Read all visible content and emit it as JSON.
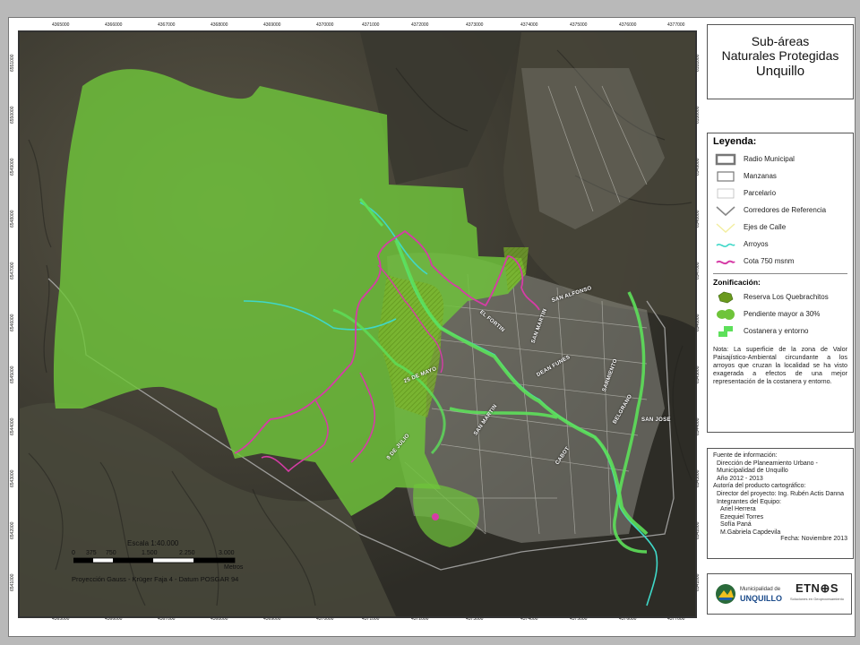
{
  "title": {
    "line1": "Sub-áreas",
    "line2": "Naturales Protegidas",
    "line3": "Unquillo"
  },
  "legend": {
    "heading": "Leyenda:",
    "items": [
      {
        "label": "Radio Municipal",
        "icon": "radio-municipal-symbol"
      },
      {
        "label": "Manzanas",
        "icon": "manzanas-symbol"
      },
      {
        "label": "Parcelario",
        "icon": "parcelario-symbol"
      },
      {
        "label": "Corredores de Referencia",
        "icon": "corredores-symbol"
      },
      {
        "label": "Ejes de Calle",
        "icon": "ejes-calle-symbol"
      },
      {
        "label": "Arroyos",
        "icon": "arroyos-symbol"
      },
      {
        "label": "Cota 750 msnm",
        "icon": "cota-symbol"
      }
    ],
    "zoning_heading": "Zonificación:",
    "zoning": [
      {
        "label": "Reserva Los Quebrachitos",
        "color": "#6a9a1e"
      },
      {
        "label": "Pendiente mayor a 30%",
        "color": "#6fc43a"
      },
      {
        "label": "Costanera y entorno",
        "color": "#5de05a"
      }
    ],
    "note": "Nota: La superficie de la zona de Valor Paisajístico-Ambiental circundante a los arroyos que cruzan la localidad se ha visto exagerada a efectos de una mejor representación de la costanera y entorno."
  },
  "source": {
    "l1": "Fuente de información:",
    "l2": "Dirección de Planeamiento Urbano -",
    "l3": "Municipalidad de Unquillo",
    "l4": "Año 2012 - 2013",
    "l5": "Autoría del producto cartográfico:",
    "l6": "Director del proyecto: Ing. Rubén Actis Danna",
    "l7": "Integrantes del Equipo:",
    "l8": "Ariel Herrera",
    "l9": "Ezequiel Torres",
    "l10": "Sofía Paná",
    "l11": "M.Gabriela Capdevila",
    "date": "Fecha: Noviembre 2013"
  },
  "logos": {
    "municipality_top": "Municipalidad de",
    "municipality_name": "UNQUILLO",
    "company_pre": "ETN",
    "company_post": "S",
    "company_tagline": "Soluciones en Geoprocesamiento"
  },
  "grid": {
    "x_labels": [
      "4365000",
      "4366000",
      "4367000",
      "4368000",
      "4369000",
      "4370000",
      "4371000",
      "4372000",
      "4373000",
      "4374000",
      "4375000",
      "4376000",
      "4377000"
    ],
    "y_labels": [
      "6551000",
      "6550000",
      "6549000",
      "6548000",
      "6547000",
      "6546000",
      "6545000",
      "6544000",
      "6543000",
      "6542000",
      "6541000"
    ]
  },
  "scale": {
    "title": "Escala 1:40.000",
    "ticks": [
      "0",
      "375",
      "750",
      "1.500",
      "2.250",
      "3.000"
    ],
    "unit": "Metros",
    "projection": "Proyección Gauss - Krüger Faja 4 - Datum POSGAR 94"
  },
  "streets": [
    "SAN ALFONSO",
    "SARMIENTO",
    "SAN MARTIN",
    "DEAN FUNES",
    "BELGRANO",
    "SAN JOSE",
    "25 DE MAYO",
    "9 DE JULIO",
    "EL FORTIN",
    "SAN MARTIN",
    "CABOT"
  ],
  "colors": {
    "reserve": "#6a9a1e",
    "slope": "#6fc43a",
    "costanera": "#5de05a",
    "cota": "#d63ca6",
    "arroyo": "#3fd8c8"
  }
}
